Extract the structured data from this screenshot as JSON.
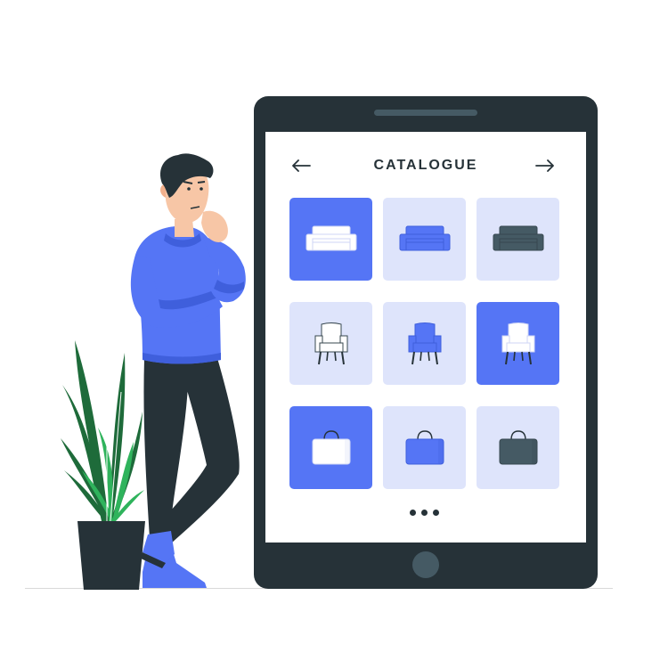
{
  "screen": {
    "title": "CATALOGUE",
    "prev_icon": "arrow-left-icon",
    "next_icon": "arrow-right-icon"
  },
  "colors": {
    "accent": "#5575f5",
    "tile_pale": "#dee4fb",
    "device": "#263238",
    "icon_dark": "#455a64",
    "plant_dark": "#1e6b3a",
    "plant_light": "#2fb35c"
  },
  "catalogue": {
    "items": [
      {
        "icon": "sofa-icon",
        "selected": true
      },
      {
        "icon": "sofa-icon",
        "selected": false
      },
      {
        "icon": "sofa-icon",
        "selected": false
      },
      {
        "icon": "armchair-icon",
        "selected": false
      },
      {
        "icon": "armchair-icon",
        "selected": false
      },
      {
        "icon": "armchair-icon",
        "selected": true
      },
      {
        "icon": "bag-icon",
        "selected": true
      },
      {
        "icon": "bag-icon",
        "selected": false
      },
      {
        "icon": "bag-icon",
        "selected": false
      }
    ],
    "more_icon": "more-dots-icon"
  }
}
